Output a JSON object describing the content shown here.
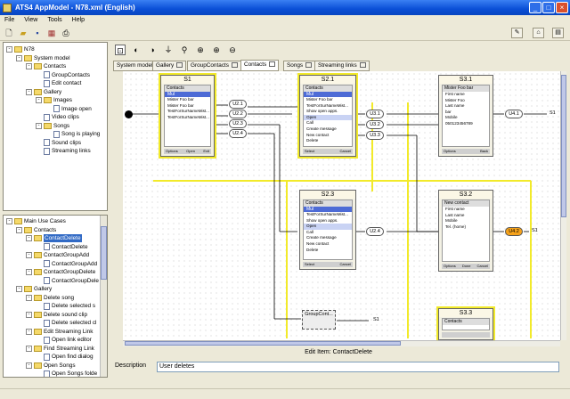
{
  "window": {
    "title": "ATS4 AppModel - N78.xml (English)"
  },
  "menu": [
    "File",
    "View",
    "Tools",
    "Help"
  ],
  "tree_top": [
    {
      "label": "N78",
      "indent": 0,
      "type": "fold",
      "tog": "-"
    },
    {
      "label": "System model",
      "indent": 1,
      "type": "fold",
      "tog": "-"
    },
    {
      "label": "Contacts",
      "indent": 2,
      "type": "fold",
      "tog": "-"
    },
    {
      "label": "GroupContacts",
      "indent": 3,
      "type": "doc"
    },
    {
      "label": "Edit contact",
      "indent": 3,
      "type": "doc"
    },
    {
      "label": "Gallery",
      "indent": 2,
      "type": "fold",
      "tog": "-"
    },
    {
      "label": "Images",
      "indent": 3,
      "type": "fold",
      "tog": "-"
    },
    {
      "label": "Image open",
      "indent": 4,
      "type": "doc"
    },
    {
      "label": "Video clips",
      "indent": 3,
      "type": "doc"
    },
    {
      "label": "Songs",
      "indent": 3,
      "type": "fold",
      "tog": "-"
    },
    {
      "label": "Song is playing",
      "indent": 4,
      "type": "doc"
    },
    {
      "label": "Sound clips",
      "indent": 3,
      "type": "doc"
    },
    {
      "label": "Streaming links",
      "indent": 3,
      "type": "doc"
    }
  ],
  "tree_bottom": [
    {
      "label": "Main Use Cases",
      "indent": 0,
      "type": "fold",
      "tog": "-"
    },
    {
      "label": "Contacts",
      "indent": 1,
      "type": "fold",
      "tog": "-"
    },
    {
      "label": "ContactDelete",
      "indent": 2,
      "type": "fold",
      "tog": "-",
      "selected": true
    },
    {
      "label": "ContactDelete",
      "indent": 3,
      "type": "doc"
    },
    {
      "label": "ContactGroupAdd",
      "indent": 2,
      "type": "fold",
      "tog": "-"
    },
    {
      "label": "ContactGroupAdd",
      "indent": 3,
      "type": "doc"
    },
    {
      "label": "ContactGroupDelete",
      "indent": 2,
      "type": "fold",
      "tog": "-"
    },
    {
      "label": "ContactGroupDele",
      "indent": 3,
      "type": "doc"
    },
    {
      "label": "Gallery",
      "indent": 1,
      "type": "fold",
      "tog": "-"
    },
    {
      "label": "Delete song",
      "indent": 2,
      "type": "fold",
      "tog": "-"
    },
    {
      "label": "Delete selected s",
      "indent": 3,
      "type": "doc"
    },
    {
      "label": "Delete sound clip",
      "indent": 2,
      "type": "fold",
      "tog": "-"
    },
    {
      "label": "Delete selected cl",
      "indent": 3,
      "type": "doc"
    },
    {
      "label": "Edit Streaming Link",
      "indent": 2,
      "type": "fold",
      "tog": "-"
    },
    {
      "label": "Open link editor",
      "indent": 3,
      "type": "doc"
    },
    {
      "label": "Find Streaming Link",
      "indent": 2,
      "type": "fold",
      "tog": "-"
    },
    {
      "label": "Open find dialog",
      "indent": 3,
      "type": "doc"
    },
    {
      "label": "Open Songs",
      "indent": 2,
      "type": "fold",
      "tog": "-"
    },
    {
      "label": "Open Songs folde",
      "indent": 3,
      "type": "doc"
    }
  ],
  "tabs": [
    "System model",
    "Gallery",
    "GroupContacts",
    "Contacts",
    "Songs",
    "Streaming links"
  ],
  "active_tab": "Contacts",
  "screens": {
    "s1": {
      "title": "S1",
      "top": "Contacts",
      "bar": "Mul",
      "items": [
        "Mister Foo bar",
        "Mister Foo bar",
        "TestForSurNameMist...",
        "TestForSurNameMist..."
      ],
      "sk": [
        "Options",
        "Open",
        "Exit"
      ]
    },
    "s21": {
      "title": "S2.1",
      "top": "Contacts",
      "bar": "Mul",
      "items": [
        "Mister Foo bar",
        "TestForSurNameMist...",
        "Show open apps.",
        "Open",
        "Call",
        "Create message",
        "New contact",
        "Delete"
      ],
      "sk": [
        "Select",
        "",
        "Cancel"
      ]
    },
    "s31": {
      "title": "S3.1",
      "top": "Mister Foo bar",
      "bar": "",
      "items": [
        "First name",
        "Mister Foo",
        "Last name",
        "bar",
        "Mobile",
        "050123456789"
      ],
      "sk": [
        "Options",
        "",
        "Back"
      ]
    },
    "s23": {
      "title": "S2.3",
      "top": "Contacts",
      "bar": "Mul",
      "items": [
        "TestForSurNameMist...",
        "Show open apps.",
        "Open",
        "Call",
        "Create message",
        "New contact",
        "Delete"
      ],
      "sk": [
        "Select",
        "",
        "Cancel"
      ]
    },
    "s32": {
      "title": "S3.2",
      "top": "New contact",
      "bar": "",
      "items": [
        "First name",
        "Last name",
        "Mobile",
        "Tel. (home)"
      ],
      "sk": [
        "Options",
        "Done",
        "Cancel"
      ]
    },
    "s33": {
      "title": "S3.3",
      "top": "Contacts",
      "bar": "",
      "items": [],
      "sk": [
        "",
        "",
        ""
      ]
    }
  },
  "pills": [
    "U2.1",
    "U2.2",
    "U2.3",
    "U2.4",
    "U3.1",
    "U3.2",
    "U3.3",
    "U4.1",
    "U4.2",
    "U2.4"
  ],
  "labels": {
    "s1_exit": "S1",
    "group": "GroupCont...",
    "group_exit": "S1",
    "u42_exit": "S1"
  },
  "edit": {
    "header": "Edit Item: ContactDelete",
    "desc_label": "Description",
    "desc_value": "User deletes"
  }
}
